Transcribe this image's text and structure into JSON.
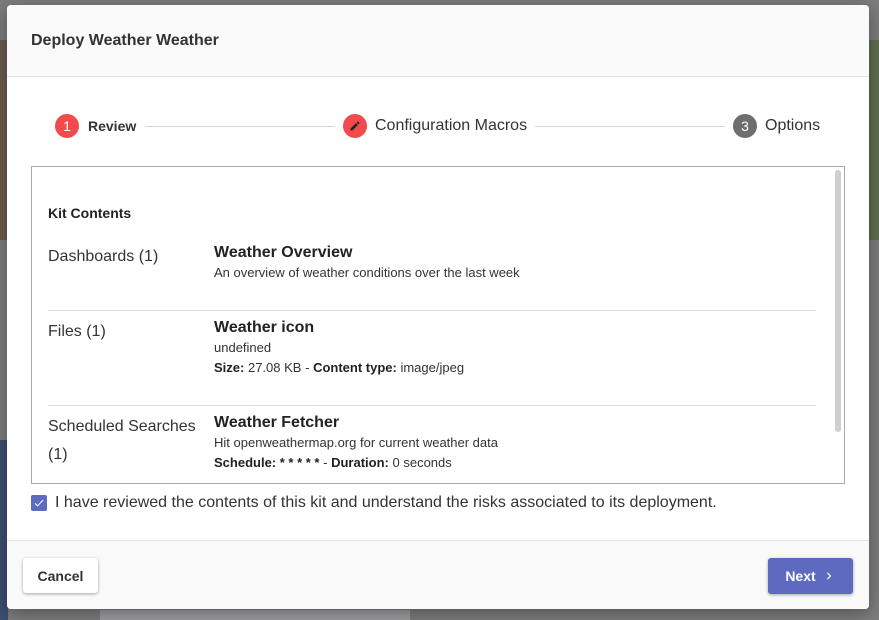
{
  "modal": {
    "title": "Deploy Weather Weather"
  },
  "stepper": {
    "steps": [
      {
        "number": "1",
        "label": "Review",
        "state": "active",
        "color": "#f24a4d"
      },
      {
        "icon": "pencil-icon",
        "label": "Configuration Macros",
        "state": "edit",
        "color": "#f24a4d"
      },
      {
        "number": "3",
        "label": "Options",
        "state": "pending",
        "color": "#6e6e6e"
      }
    ]
  },
  "kit": {
    "heading": "Kit Contents",
    "sections": [
      {
        "label": "Dashboards (1)",
        "title": "Weather Overview",
        "description": "An overview of weather conditions over the last week"
      },
      {
        "label": "Files (1)",
        "title": "Weather icon",
        "description": "undefined",
        "size_label": "Size:",
        "size_value": "27.08 KB",
        "sep": "-",
        "type_label": "Content type:",
        "type_value": "image/jpeg"
      },
      {
        "label": "Scheduled Searches (1)",
        "title": "Weather Fetcher",
        "description": "Hit openweathermap.org for current weather data",
        "schedule_label": "Schedule:",
        "schedule_value": "* * * * *",
        "sep": "-",
        "duration_label": "Duration:",
        "duration_value": "0 seconds"
      }
    ]
  },
  "acknowledge": {
    "checked": true,
    "text": "I have reviewed the contents of this kit and understand the risks associated to its deployment."
  },
  "footer": {
    "cancel_label": "Cancel",
    "next_label": "Next"
  },
  "colors": {
    "accent": "#5c6bc0",
    "step_active": "#f24a4d",
    "step_pending": "#6e6e6e"
  }
}
